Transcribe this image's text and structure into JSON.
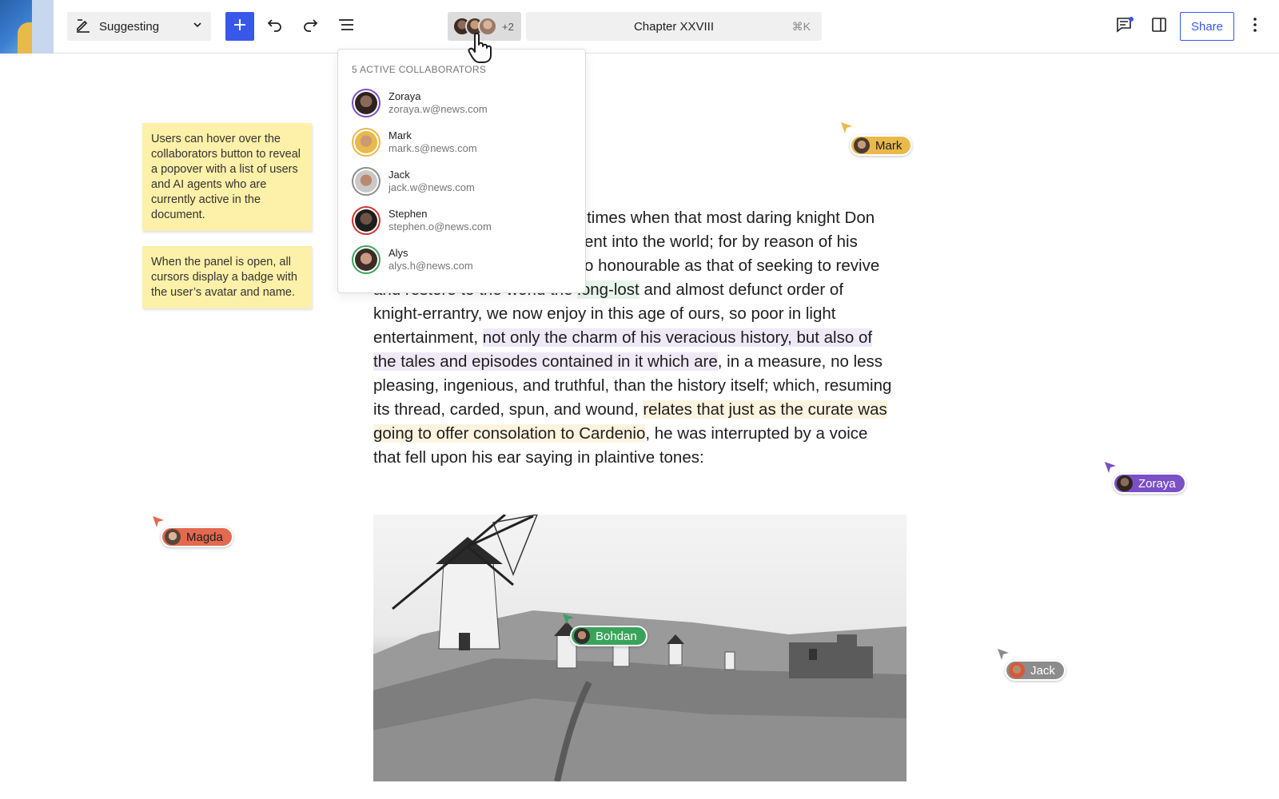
{
  "toolbar": {
    "mode_label": "Suggesting",
    "collaborators_more": "+2",
    "command_title": "Chapter XXVIII",
    "command_shortcut": "⌘K",
    "share_label": "Share"
  },
  "popover": {
    "heading": "5 ACTIVE COLLABORATORS",
    "users": [
      {
        "name": "Zoraya",
        "email": "zoraya.w@news.com",
        "ring": "#7b4fc6"
      },
      {
        "name": "Mark",
        "email": "mark.s@news.com",
        "ring": "#e9b949"
      },
      {
        "name": "Jack",
        "email": "jack.w@news.com",
        "ring": "#8c8c8c"
      },
      {
        "name": "Stephen",
        "email": "stephen.o@news.com",
        "ring": "#d0342c"
      },
      {
        "name": "Alys",
        "email": "alys.h@news.com",
        "ring": "#3aa35a"
      }
    ]
  },
  "notes": {
    "note1": "Users can hover over the collaborators button to reveal a popover with a list of users and AI agents who are currently active in the document.",
    "note2": "When the panel is open, all cursors display a badge with the user’s avatar and name."
  },
  "doc": {
    "p1": "e times when that most daring knight Don",
    "p2": "ent into the world; for by reason of his",
    "p3": "o honourable as that of seeking to revive",
    "p4a": "and restore to the world the ",
    "p4b": "long-lost",
    "p4c": " and almost defunct order of",
    "p5": "knight-errantry, we now enjoy in this age of ours, so poor in light",
    "p6a": "entertainment, ",
    "p6b": "not only the charm of his veracious history, but also of",
    "p7a": "the tales and episodes contained in it which are",
    "p7b": ", in a measure, no less",
    "p8": "pleasing, ingenious, and truthful, than the history itself; which, resuming",
    "p9a": "its thread, carded, spun, and wound, ",
    "p9b": "relates that just as the curate was",
    "p10a": "going to offer consolation to Cardenio",
    "p10b": ", he was interrupted by a voice",
    "p11": "that fell upon his ear saying in plaintive tones:"
  },
  "cursors": {
    "mark": {
      "name": "Mark",
      "color": "#e9b949",
      "text": "#1e1e1e"
    },
    "zoraya": {
      "name": "Zoraya",
      "color": "#7b4fc6",
      "text": "#ffffff"
    },
    "magda": {
      "name": "Magda",
      "color": "#e3694f",
      "text": "#1e1e1e"
    },
    "bohdan": {
      "name": "Bohdan",
      "color": "#3aa35a",
      "text": "#ffffff"
    },
    "jack": {
      "name": "Jack",
      "color": "#8c8c8c",
      "text": "#ffffff"
    }
  },
  "icons": [
    "pen-icon",
    "chevron-down-icon",
    "plus-icon",
    "undo-icon",
    "redo-icon",
    "list-view-icon",
    "comments-icon",
    "sidebar-icon",
    "more-vertical-icon",
    "hand-pointer-icon"
  ]
}
